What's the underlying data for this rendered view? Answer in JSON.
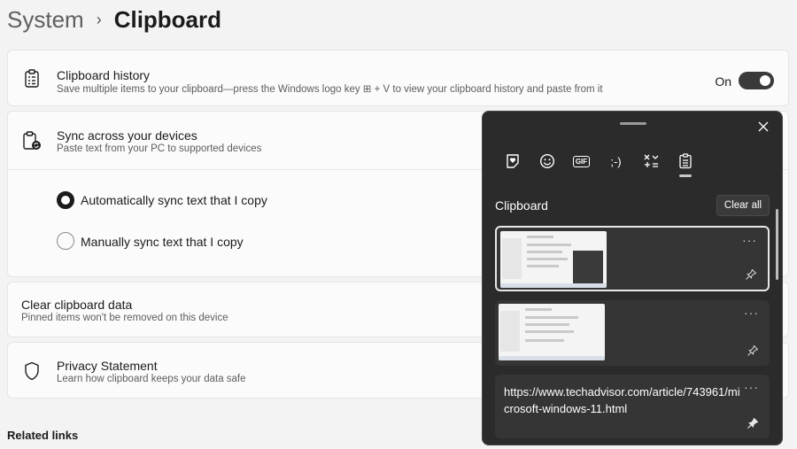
{
  "breadcrumb": {
    "parent": "System",
    "separator": "›",
    "current": "Clipboard"
  },
  "clipboard_history": {
    "title": "Clipboard history",
    "description": "Save multiple items to your clipboard—press the Windows logo key ⊞ + V to view your clipboard history and paste from it",
    "toggle_label": "On",
    "toggle_state": true,
    "icon": "clipboard-list-icon"
  },
  "sync": {
    "title": "Sync across your devices",
    "description": "Paste text from your PC to supported devices",
    "icon": "clipboard-sync-icon",
    "options": [
      {
        "label": "Automatically sync text that I copy",
        "selected": true
      },
      {
        "label": "Manually sync text that I copy",
        "selected": false
      }
    ]
  },
  "clear_data": {
    "title": "Clear clipboard data",
    "description": "Pinned items won't be removed on this device"
  },
  "privacy": {
    "title": "Privacy Statement",
    "description": "Learn how clipboard keeps your data safe",
    "icon": "shield-icon"
  },
  "related_links": "Related links",
  "flyout": {
    "tabs": [
      {
        "name": "stickers-icon",
        "active": false
      },
      {
        "name": "emoji-icon",
        "active": false
      },
      {
        "name": "gif-icon",
        "label": "GIF",
        "active": false
      },
      {
        "name": "kaomoji-icon",
        "label": ";-)",
        "active": false
      },
      {
        "name": "symbols-icon",
        "active": false
      },
      {
        "name": "clipboard-icon",
        "active": true
      }
    ],
    "section_title": "Clipboard",
    "clear_all": "Clear all",
    "items": [
      {
        "type": "image",
        "selected": true,
        "more": "···",
        "pinned": false
      },
      {
        "type": "image",
        "selected": false,
        "more": "···",
        "pinned": false
      },
      {
        "type": "text",
        "selected": false,
        "more": "···",
        "pinned": true,
        "text": "https://www.techadvisor.com/article/743961/microsoft-windows-11.html"
      }
    ]
  }
}
